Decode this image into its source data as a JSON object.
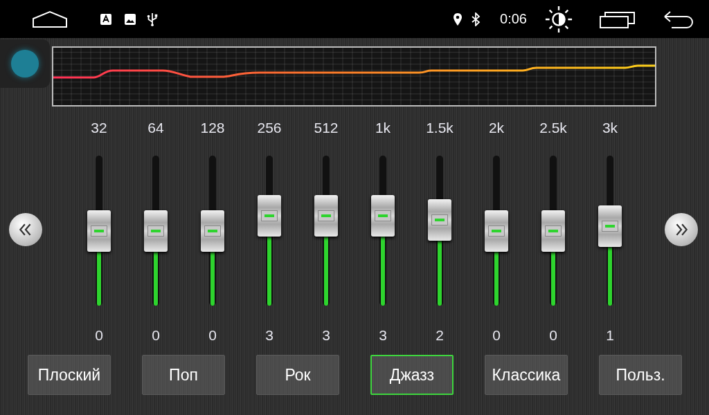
{
  "status_bar": {
    "time": "0:06"
  },
  "bands": [
    {
      "frequency": "32",
      "value": "0",
      "level": 0.5
    },
    {
      "frequency": "64",
      "value": "0",
      "level": 0.5
    },
    {
      "frequency": "128",
      "value": "0",
      "level": 0.5
    },
    {
      "frequency": "256",
      "value": "3",
      "level": 0.6
    },
    {
      "frequency": "512",
      "value": "3",
      "level": 0.6
    },
    {
      "frequency": "1k",
      "value": "3",
      "level": 0.6
    },
    {
      "frequency": "1.5k",
      "value": "2",
      "level": 0.57
    },
    {
      "frequency": "2k",
      "value": "0",
      "level": 0.5
    },
    {
      "frequency": "2.5k",
      "value": "0",
      "level": 0.5
    },
    {
      "frequency": "3k",
      "value": "1",
      "level": 0.53
    }
  ],
  "presets": [
    {
      "label": "Плоский",
      "selected": false
    },
    {
      "label": "Поп",
      "selected": false
    },
    {
      "label": "Рок",
      "selected": false
    },
    {
      "label": "Джазз",
      "selected": true
    },
    {
      "label": "Классика",
      "selected": false
    },
    {
      "label": "Польз.",
      "selected": false
    }
  ]
}
